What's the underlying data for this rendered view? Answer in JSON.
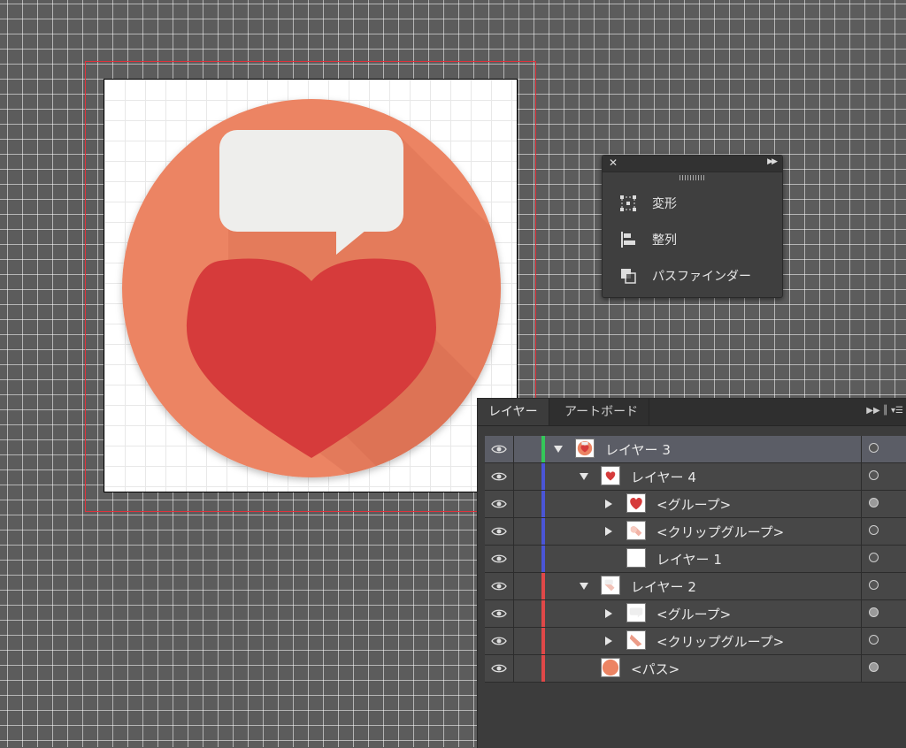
{
  "mini_panel": {
    "items": [
      {
        "label": "変形",
        "icon": "transform-icon"
      },
      {
        "label": "整列",
        "icon": "align-icon"
      },
      {
        "label": "パスファインダー",
        "icon": "pathfinder-icon"
      }
    ]
  },
  "layers_panel": {
    "tabs": [
      "レイヤー",
      "アートボード"
    ],
    "rows": [
      {
        "name": "レイヤー 3",
        "indent": 0,
        "expand": "down",
        "color": "#34c759",
        "selected": true,
        "thumb": "circle-heart",
        "target_filled": false
      },
      {
        "name": "レイヤー 4",
        "indent": 1,
        "expand": "down",
        "color": "#4a55d6",
        "selected": false,
        "thumb": "heart",
        "target_filled": false
      },
      {
        "name": "<グループ>",
        "indent": 2,
        "expand": "right",
        "color": "#4a55d6",
        "selected": false,
        "thumb": "heart-big",
        "target_filled": true
      },
      {
        "name": "<クリップグループ>",
        "indent": 2,
        "expand": "right",
        "color": "#4a55d6",
        "selected": false,
        "thumb": "shadow-pink",
        "target_filled": false
      },
      {
        "name": "レイヤー 1",
        "indent": 2,
        "expand": "none",
        "color": "#4a55d6",
        "selected": false,
        "thumb": "blank",
        "target_filled": false
      },
      {
        "name": "レイヤー 2",
        "indent": 1,
        "expand": "down",
        "color": "#e04848",
        "selected": false,
        "thumb": "bubble",
        "target_filled": false
      },
      {
        "name": "<グループ>",
        "indent": 2,
        "expand": "right",
        "color": "#e04848",
        "selected": false,
        "thumb": "bubble-white",
        "target_filled": true
      },
      {
        "name": "<クリップグループ>",
        "indent": 2,
        "expand": "right",
        "color": "#e04848",
        "selected": false,
        "thumb": "shadow-salmon",
        "target_filled": false
      },
      {
        "name": "<パス>",
        "indent": 1,
        "expand": "none",
        "color": "#e04848",
        "selected": false,
        "thumb": "circle",
        "target_filled": true
      }
    ]
  },
  "colors": {
    "circle": "#ec8463",
    "heart": "#d63b3b",
    "bubble": "#eeeeec",
    "canvas": "#5c5c5c",
    "bleed": "#e0323c"
  }
}
